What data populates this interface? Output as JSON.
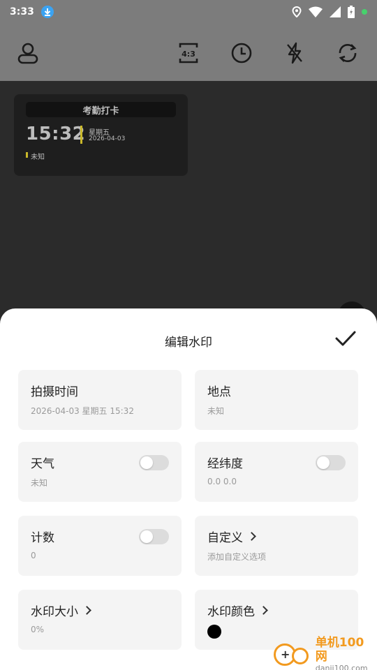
{
  "status_bar": {
    "time": "3:33"
  },
  "watermark": {
    "title": "考勤打卡",
    "time": "15:32",
    "weekday": "星期五",
    "date": "2026-04-03",
    "location": "未知"
  },
  "sheet": {
    "title": "编辑水印",
    "tiles": {
      "shoot_time": {
        "label": "拍摄时间",
        "value": "2026-04-03 星期五 15:32"
      },
      "location": {
        "label": "地点",
        "value": "未知"
      },
      "weather": {
        "label": "天气",
        "value": "未知",
        "enabled": false
      },
      "coords": {
        "label": "经纬度",
        "value": "0.0 0.0",
        "enabled": false
      },
      "count": {
        "label": "计数",
        "value": "0",
        "enabled": false
      },
      "custom": {
        "label": "自定义",
        "value": "添加自定义选项"
      },
      "size": {
        "label": "水印大小",
        "value": "0%"
      },
      "color": {
        "label": "水印颜色",
        "color": "#000000"
      }
    }
  },
  "logo": {
    "cn": "单机100网",
    "en": "danji100.com"
  }
}
